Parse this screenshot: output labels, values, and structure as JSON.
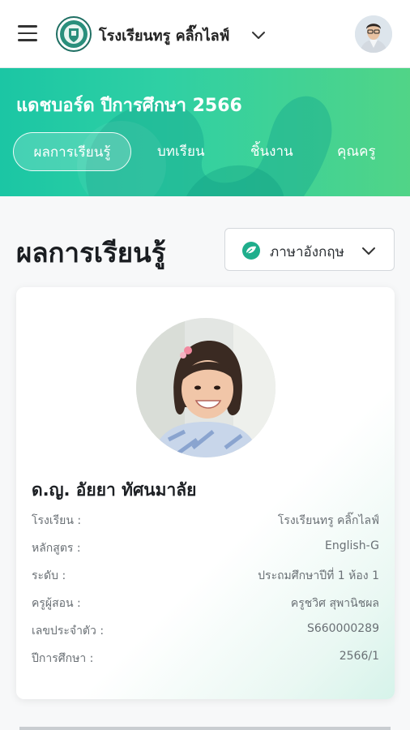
{
  "header": {
    "school_name": "โรงเรียนทรู คลิ๊กไลฟ์",
    "icons": [
      "menu-icon",
      "school-logo",
      "chevron-down-icon",
      "teacher-avatar"
    ]
  },
  "banner": {
    "title": "แดชบอร์ด ปีการศึกษา 2566",
    "tabs": [
      {
        "label": "ผลการเรียนรู้",
        "active": true
      },
      {
        "label": "บทเรียน",
        "active": false
      },
      {
        "label": "ชิ้นงาน",
        "active": false
      },
      {
        "label": "คุณครู",
        "active": false
      }
    ]
  },
  "section": {
    "title": "ผลการเรียนรู้",
    "subject_select": {
      "label": "ภาษาอังกฤษ",
      "icon": "subject-leaf-icon"
    }
  },
  "student": {
    "name": "ด.ญ. อัยยา ทัศนมาลัย",
    "details": [
      {
        "label": "โรงเรียน :",
        "value": "โรงเรียนทรู คลิ๊กไลฟ์"
      },
      {
        "label": "หลักสูตร :",
        "value": "English-G"
      },
      {
        "label": "ระดับ :",
        "value": "ประถมศึกษาปีที่ 1 ห้อง 1"
      },
      {
        "label": "ครูผู้สอน :",
        "value": "ครูชวิศ สุพานิชผล"
      },
      {
        "label": "เลขประจำตัว :",
        "value": "S660000289"
      },
      {
        "label": "ปีการศึกษา :",
        "value": "2566/1"
      }
    ]
  },
  "colors": {
    "banner_start": "#1bc6a4",
    "banner_end": "#51d487",
    "accent": "#1fae8c"
  }
}
